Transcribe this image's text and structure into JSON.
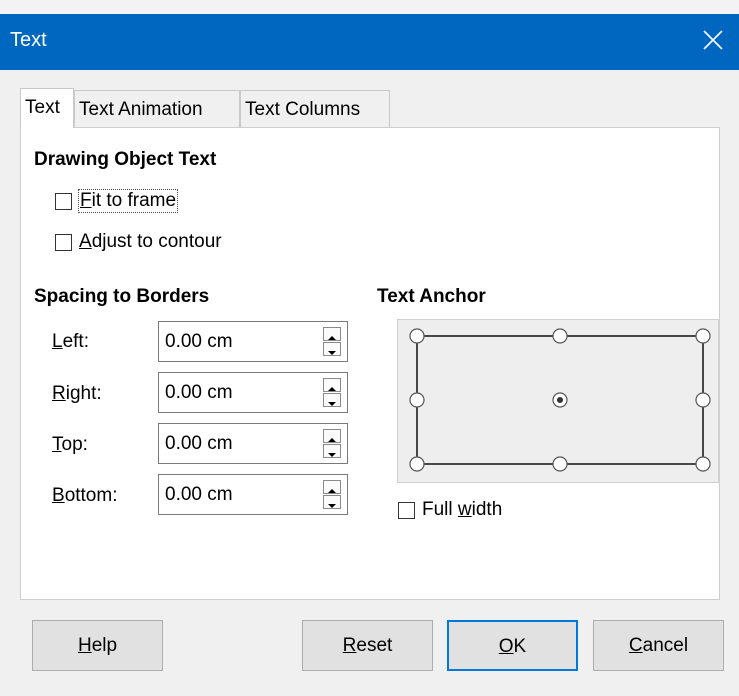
{
  "window": {
    "title": "Text"
  },
  "tabs": [
    {
      "label": "Text"
    },
    {
      "label": "Text Animation"
    },
    {
      "label": "Text Columns"
    }
  ],
  "drawing": {
    "heading": "Drawing Object Text",
    "fit_to_frame": {
      "mnemonic": "F",
      "rest": "it to frame",
      "checked": false
    },
    "adjust_to_contour": {
      "mnemonic": "A",
      "rest": "djust to contour",
      "checked": false
    }
  },
  "spacing": {
    "heading": "Spacing to Borders",
    "fields": [
      {
        "mnemonic": "L",
        "rest": "eft:",
        "value": "0.00 cm"
      },
      {
        "mnemonic": "R",
        "rest": "ight:",
        "value": "0.00 cm"
      },
      {
        "mnemonic": "T",
        "rest": "op:",
        "value": "0.00 cm"
      },
      {
        "mnemonic": "B",
        "rest": "ottom:",
        "value": "0.00 cm"
      }
    ]
  },
  "anchor": {
    "heading": "Text Anchor",
    "selected": "center",
    "full_width": {
      "before": "Full ",
      "mnemonic": "w",
      "rest": "idth",
      "checked": false
    }
  },
  "buttons": {
    "help": {
      "mnemonic": "H",
      "rest": "elp"
    },
    "reset": {
      "mnemonic": "R",
      "rest": "eset"
    },
    "ok": {
      "mnemonic": "O",
      "rest": "K"
    },
    "cancel": {
      "mnemonic": "C",
      "rest": "ancel"
    }
  },
  "colors": {
    "titlebar": "#0067c0",
    "default_button_border": "#0078d7"
  }
}
